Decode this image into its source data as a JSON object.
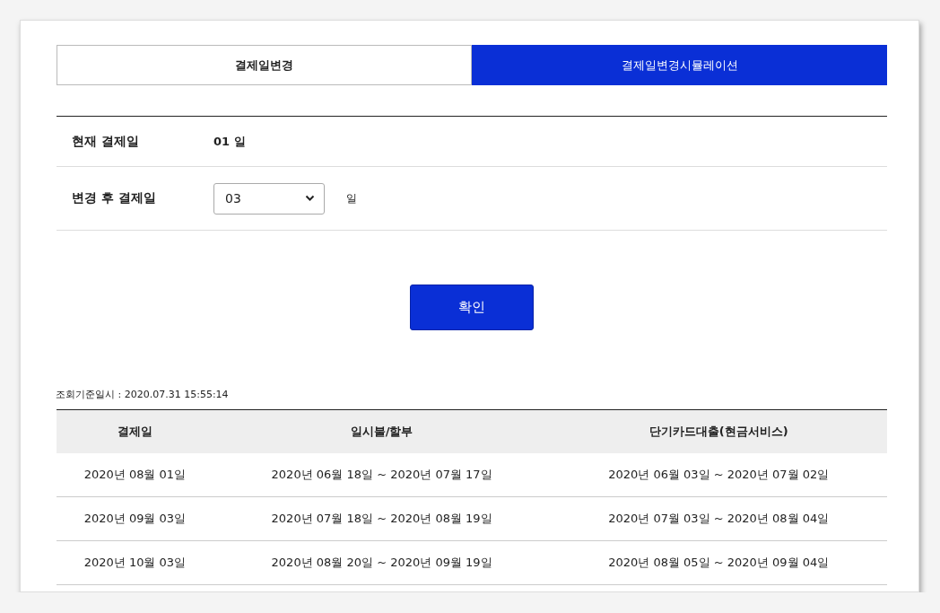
{
  "tabs": [
    {
      "label": "결제일변경",
      "selected": false
    },
    {
      "label": "결제일변경시뮬레이션",
      "selected": true
    }
  ],
  "form": {
    "rows": [
      {
        "label": "현재 결제일",
        "kind": "text",
        "value": "01 일"
      },
      {
        "label": "변경 후 결제일",
        "kind": "select",
        "value": "03",
        "unit": "일"
      }
    ]
  },
  "confirm_button": "확인",
  "timestamp": "조회기준일시 : 2020.07.31 15:55:14",
  "table": {
    "columns": [
      "결제일",
      "일시불/할부",
      "단기카드대출(현금서비스)"
    ],
    "rows": [
      [
        "2020년 08월 01일",
        "2020년 06월 18일 ~ 2020년 07월 17일",
        "2020년 06월 03일 ~ 2020년 07월 02일"
      ],
      [
        "2020년 09월 03일",
        "2020년 07월 18일 ~ 2020년 08월 19일",
        "2020년 07월 03일 ~ 2020년 08월 04일"
      ],
      [
        "2020년 10월 03일",
        "2020년 08월 20일 ~ 2020년 09월 19일",
        "2020년 08월 05일 ~ 2020년 09월 04일"
      ]
    ]
  }
}
